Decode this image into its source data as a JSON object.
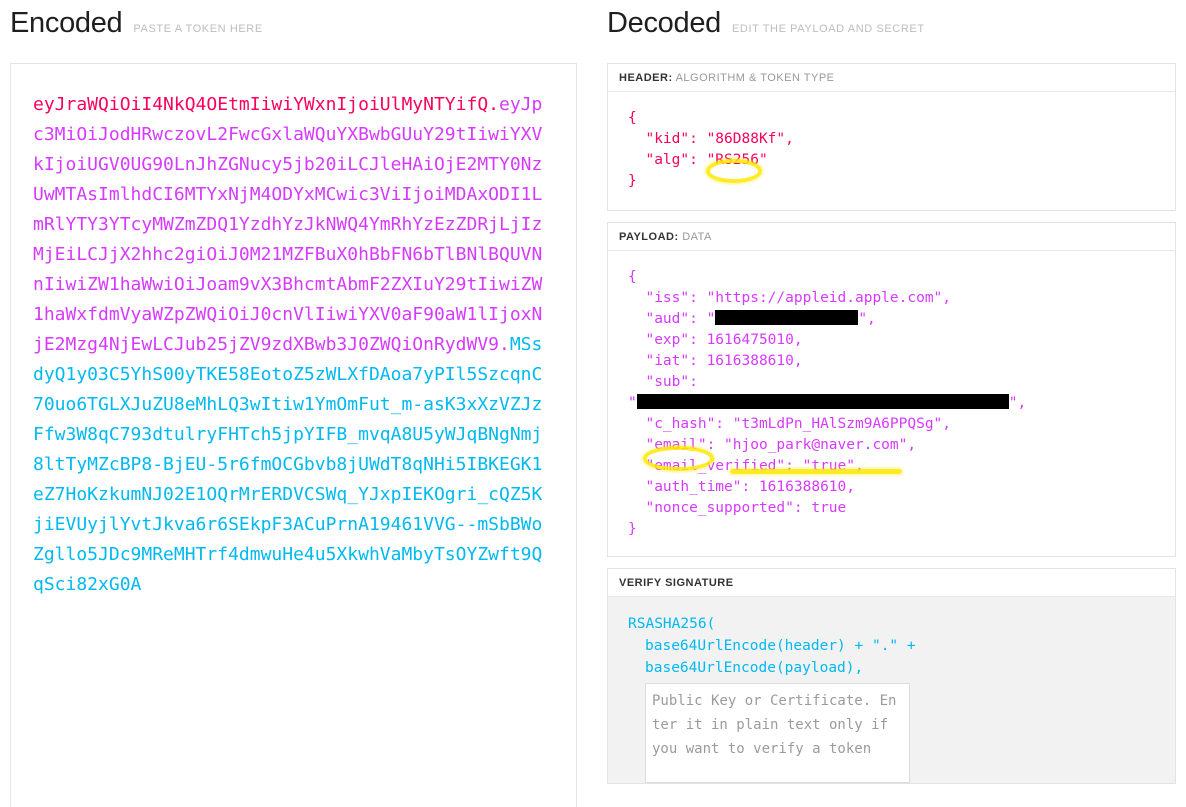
{
  "encoded": {
    "title": "Encoded",
    "subtitle": "PASTE A TOKEN HERE",
    "token": {
      "header_b64": "eyJraWQiOiI4NkQ4OEtmIiwiYWxnIjoiUlMyNTYifQ",
      "payload_b64": "eyJpc3MiOiJodHRwczovL2FwcGxlaWQuYXBwbGUuY29tIiwiYXVkIjoiUGV0UG90LnJhZGNucy5jb20iLCJleHAiOjE2MTY0NzUwMTAsImlhdCI6MTYxNjM4ODYxMCwic3ViIjoiMDAxODI1LmRlYTY3YTcyMWZmZDQ1YzdhYzJkNWQ4YmRhYzEzZDRjLjIzMjEiLCJjX2hhc2giOiJ0M21MZFBuX0hBbFN6bTlBNlBQUVNnIiwiZW1haWwiOiJoam9vX3BhcmtAbmF2ZXIuY29tIiwiZW1haWxfdmVyaWZpZWQiOiJ0cnVlIiwiYXV0aF90aW1lIjoxNjE2Mzg4NjEwLCJub25jZV9zdXBwb3J0ZWQiOnRydWV9",
      "signature_b64": "MSsdyQ1y03C5YhS00yTKE58EotoZ5zWLXfDAoa7yPIl5SzcqnC70uo6TGLXJuZU8eMhLQ3wItiw1YmOmFut_m-asK3xXzVZJzFfw3W8qC793dtulryFHTch5jpYIFB_mvqA8U5yWJqBNgNmj8ltTyMZcBP8-BjEU-5r6fmOCGbvb8jUWdT8qNHi5IBKEGK1eZ7HoKzkumNJ02E1OQrMrERDVCSWq_YJxpIEKOgri_cQZ5KjiEVUyjlYvtJkva6r6SEkpF3ACuPrnA19461VVG--mSbBWoZgllo5JDc9MReMHTrf4dmwuHe4u5XkwhVaMbyTsOYZwft9QqSci82xG0A",
      "separator": "."
    }
  },
  "decoded": {
    "title": "Decoded",
    "subtitle": "EDIT THE PAYLOAD AND SECRET",
    "header_section": {
      "label_strong": "HEADER:",
      "label_rest": "ALGORITHM & TOKEN TYPE",
      "lines": [
        "{",
        "  \"kid\": \"86D88Kf\",",
        "  \"alg\": \"RS256\"",
        "}"
      ],
      "kid": "86D88Kf",
      "alg": "RS256"
    },
    "payload_section": {
      "label_strong": "PAYLOAD:",
      "label_rest": "DATA",
      "open_brace": "{",
      "close_brace": "}",
      "iss_line": "  \"iss\": \"https://appleid.apple.com\",",
      "aud_prefix": "  \"aud\": \"",
      "aud_suffix": "\",",
      "aud_value_redacted": true,
      "exp_line": "  \"exp\": 1616475010,",
      "iat_line": "  \"iat\": 1616388610,",
      "sub_key_line": "  \"sub\":",
      "sub_prefix": "\"",
      "sub_suffix": "\",",
      "sub_value_redacted": true,
      "c_hash_line": "  \"c_hash\": \"t3mLdPn_HAlSzm9A6PPQSg\",",
      "email_line": "  \"email\": \"hjoo_park@naver.com\",",
      "email_verified_line": "  \"email_verified\": \"true\",",
      "auth_time_line": "  \"auth_time\": 1616388610,",
      "nonce_supported_line": "  \"nonce_supported\": true",
      "values": {
        "iss": "https://appleid.apple.com",
        "exp": "1616475010",
        "iat": "1616388610",
        "c_hash": "t3mLdPn_HAlSzm9A6PPQSg",
        "email": "hjoo_park@naver.com",
        "email_verified": "true",
        "auth_time": "1616388610",
        "nonce_supported": "true"
      }
    },
    "signature_section": {
      "label_strong": "VERIFY SIGNATURE",
      "label_rest": "",
      "line1": "RSASHA256(",
      "line2": "base64UrlEncode(header) + \".\" +",
      "line3": "base64UrlEncode(payload),",
      "pubkey_placeholder": "Public Key or Certificate. Enter it in plain text only if you want to verify a token",
      "pubkey_value": ""
    }
  },
  "annotations": {
    "highlight_color": "#ffe800",
    "items": [
      {
        "name": "alg-value-circled",
        "target": "RS256",
        "style": "ellipse"
      },
      {
        "name": "email-key-circled",
        "target": "\"email\"",
        "style": "ellipse"
      },
      {
        "name": "email-value-underlined",
        "target": "hjoo_park@naver.com",
        "style": "underline"
      }
    ]
  },
  "colors": {
    "header_segment": "#fb015b",
    "payload_segment": "#d63aff",
    "signature_segment": "#00b9f1",
    "redaction": "#000000"
  }
}
